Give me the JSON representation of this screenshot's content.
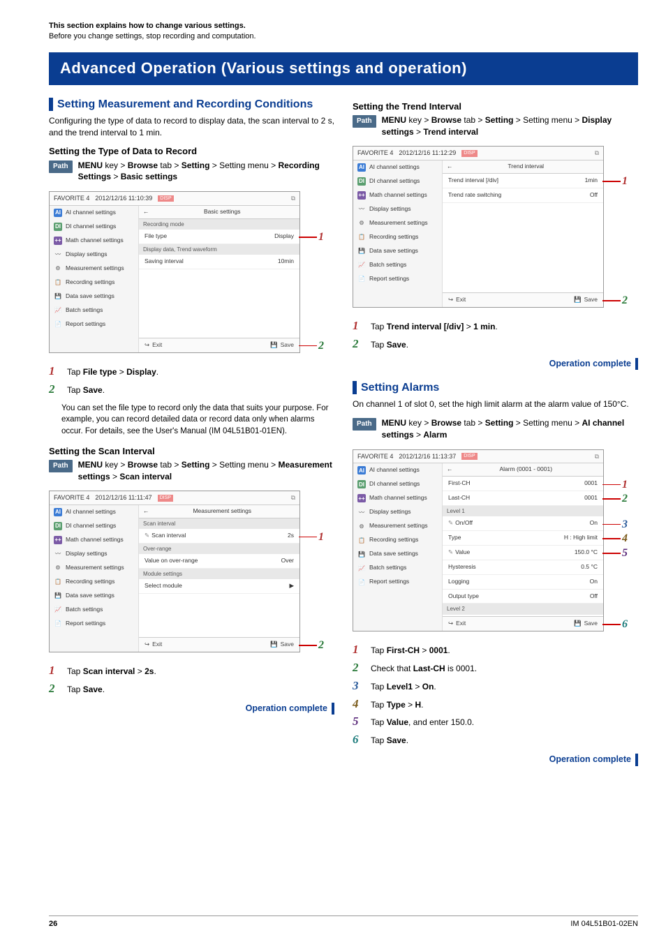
{
  "intro_bold": "This section explains how to change various settings.",
  "intro_sub": "Before you change settings, stop recording and computation.",
  "banner": "Advanced Operation (Various settings and operation)",
  "left": {
    "h2": "Setting Measurement and Recording Conditions",
    "body": "Configuring the type of data to record to display data, the scan interval to 2 s, and the trend interval to 1 min.",
    "sec1": {
      "h3": "Setting the Type of Data to Record",
      "path_label": "Path",
      "path": "<b>MENU</b> key > <b>Browse</b> tab > <b>Setting</b> > Setting menu > <b>Recording Settings</b> > <b>Basic settings</b>",
      "shot": {
        "fav": "FAVORITE 4",
        "ts": "2012/12/16 11:10:39",
        "disp": "DISP",
        "title": "Basic settings",
        "rows": [
          {
            "group": "Recording mode"
          },
          {
            "label": "File type",
            "value": "Display",
            "callout": "1"
          },
          {
            "group": "Display data, Trend waveform"
          },
          {
            "label": "Saving interval",
            "value": "10min"
          }
        ],
        "exit": "Exit",
        "save": "Save",
        "save_callout": "2"
      },
      "step1": "Tap <b>File type</b> > <b>Display</b>.",
      "step2": "Tap <b>Save</b>.",
      "note": "You can set the file type to record only the data that suits your purpose. For example, you can record detailed data or record data only when alarms occur. For details, see the User's Manual (IM 04L51B01-01EN)."
    },
    "sec2": {
      "h3": "Setting the Scan Interval",
      "path_label": "Path",
      "path": "<b>MENU</b> key > <b>Browse</b> tab > <b>Setting</b> > Setting menu > <b>Measurement settings</b> > <b>Scan interval</b>",
      "shot": {
        "fav": "FAVORITE 4",
        "ts": "2012/12/16 11:11:47",
        "disp": "DISP",
        "title": "Measurement settings",
        "rows": [
          {
            "group": "Scan interval"
          },
          {
            "label": "Scan interval",
            "value": "2s",
            "pencil": true,
            "callout": "1"
          },
          {
            "group": "Over-range"
          },
          {
            "label": "Value on over-range",
            "value": "Over"
          },
          {
            "group": "Module settings"
          },
          {
            "label": "Select module",
            "value": "▶"
          }
        ],
        "exit": "Exit",
        "save": "Save",
        "save_callout": "2"
      },
      "step1": "Tap <b>Scan interval</b> > <b>2s</b>.",
      "step2": "Tap <b>Save</b>.",
      "complete": "Operation complete"
    }
  },
  "right": {
    "sec3": {
      "h3": "Setting the Trend Interval",
      "path_label": "Path",
      "path": "<b>MENU</b> key > <b>Browse</b> tab > <b>Setting</b> > Setting menu > <b>Display settings</b> > <b>Trend interval</b>",
      "shot": {
        "fav": "FAVORITE 4",
        "ts": "2012/12/16 11:12:29",
        "disp": "DISP",
        "title": "Trend interval",
        "rows": [
          {
            "label": "Trend interval [/div]",
            "value": "1min",
            "callout": "1"
          },
          {
            "label": "Trend rate switching",
            "value": "Off"
          }
        ],
        "exit": "Exit",
        "save": "Save",
        "save_callout": "2"
      },
      "step1": "Tap <b>Trend interval [/div]</b> > <b>1 min</b>.",
      "step2": "Tap <b>Save</b>.",
      "complete": "Operation complete"
    },
    "h2": "Setting Alarms",
    "body": "On channel 1 of slot 0, set the high limit alarm at the alarm value of 150°C.",
    "sec4": {
      "path_label": "Path",
      "path": "<b>MENU</b> key > <b>Browse</b> tab > <b>Setting</b> > Setting menu > <b>AI channel settings</b> > <b>Alarm</b>",
      "shot": {
        "fav": "FAVORITE 4",
        "ts": "2012/12/16 11:13:37",
        "disp": "DISP",
        "title": "Alarm (0001 - 0001)",
        "rows": [
          {
            "label": "First-CH",
            "value": "0001",
            "callout": "1"
          },
          {
            "label": "Last-CH",
            "value": "0001",
            "callout": "2"
          },
          {
            "group": "Level 1"
          },
          {
            "label": "On/Off",
            "value": "On",
            "pencil": true,
            "callout": "3"
          },
          {
            "label": "Type",
            "value": "H : High limit",
            "callout": "4"
          },
          {
            "label": "Value",
            "value": "150.0 °C",
            "pencil": true,
            "callout": "5"
          },
          {
            "label": "Hysteresis",
            "value": "0.5 °C"
          },
          {
            "label": "Logging",
            "value": "On"
          },
          {
            "label": "Output type",
            "value": "Off"
          },
          {
            "group": "Level 2"
          }
        ],
        "exit": "Exit",
        "save": "Save",
        "save_callout": "6"
      },
      "step1": "Tap <b>First-CH</b> > <b>0001</b>.",
      "step2": "Check that <b>Last-CH</b> is 0001.",
      "step3": "Tap <b>Level1</b> > <b>On</b>.",
      "step4": "Tap <b>Type</b> > <b>H</b>.",
      "step5": "Tap <b>Value</b>, and enter 150.0.",
      "step6": "Tap <b>Save</b>.",
      "complete": "Operation complete"
    }
  },
  "side_items": [
    {
      "ico": "AI",
      "cls": "ai",
      "label": "AI channel settings"
    },
    {
      "ico": "DI",
      "cls": "di",
      "label": "DI channel settings"
    },
    {
      "ico": "++",
      "cls": "math",
      "label": "Math channel settings"
    },
    {
      "ico": "〰",
      "cls": "",
      "label": "Display settings"
    },
    {
      "ico": "⚙",
      "cls": "",
      "label": "Measurement settings"
    },
    {
      "ico": "📋",
      "cls": "",
      "label": "Recording settings"
    },
    {
      "ico": "💾",
      "cls": "",
      "label": "Data save settings"
    },
    {
      "ico": "📈",
      "cls": "",
      "label": "Batch settings"
    },
    {
      "ico": "📄",
      "cls": "",
      "label": "Report settings"
    }
  ],
  "footer": {
    "page": "26",
    "doc": "IM 04L51B01-02EN"
  }
}
